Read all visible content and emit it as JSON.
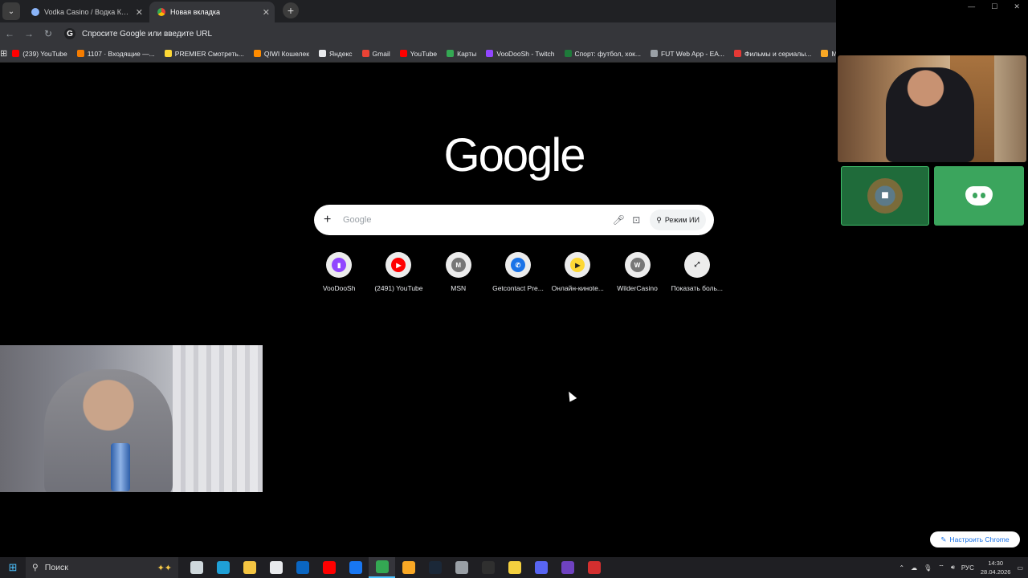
{
  "browser": {
    "tabs": [
      {
        "title": "Vodka Casino / Водка Казино -",
        "active": false
      },
      {
        "title": "Новая вкладка",
        "active": true
      }
    ],
    "omnibox_placeholder": "Спросите Google или введите URL",
    "bookmarks": [
      {
        "label": "(239) YouTube",
        "color": "#ff0000"
      },
      {
        "label": "1107 · Входящие —...",
        "color": "#f57c00"
      },
      {
        "label": "PREMIER Смотреть...",
        "color": "#fdd835"
      },
      {
        "label": "QIWI Кошелек",
        "color": "#ff8c00"
      },
      {
        "label": "Яндекс",
        "color": "#e8eaed"
      },
      {
        "label": "Gmail",
        "color": "#ea4335"
      },
      {
        "label": "YouTube",
        "color": "#ff0000"
      },
      {
        "label": "Карты",
        "color": "#34a853"
      },
      {
        "label": "VooDooSh - Twitch",
        "color": "#9146ff"
      },
      {
        "label": "Спорт: футбол, хок...",
        "color": "#1e7b3a"
      },
      {
        "label": "FUT Web App - EA...",
        "color": "#9aa0a6"
      },
      {
        "label": "Фильмы и сериалы...",
        "color": "#e53935"
      },
      {
        "label": "MyScore",
        "color": "#f9a825"
      }
    ]
  },
  "newtab": {
    "logo": "Google",
    "search_placeholder": "Google",
    "ai_mode_label": "Режим ИИ",
    "shortcuts": [
      {
        "label": "VooDooSh",
        "icon": "twitch-icon",
        "color": "#9146ff",
        "glyph": "▮"
      },
      {
        "label": "(2491) YouTube",
        "icon": "youtube-icon",
        "color": "#ff0000",
        "glyph": "▶"
      },
      {
        "label": "MSN",
        "icon": "letter-m-icon",
        "color": "#777777",
        "glyph": "M"
      },
      {
        "label": "Getcontact Pre...",
        "icon": "phone-icon",
        "color": "#1a73e8",
        "glyph": "✆"
      },
      {
        "label": "Онлайн-кинote...",
        "icon": "play-icon",
        "color": "#fdd835",
        "glyph": "▶"
      },
      {
        "label": "WilderCasino",
        "icon": "letter-w-icon",
        "color": "#777777",
        "glyph": "W"
      },
      {
        "label": "Показать боль...",
        "icon": "expand-icon",
        "color": "#ececec",
        "glyph": "⤢"
      }
    ],
    "customize_label": "Настроить Chrome"
  },
  "taskbar": {
    "search_label": "Поиск",
    "icons": [
      {
        "name": "task-view-icon",
        "color": "#cfd8dc"
      },
      {
        "name": "edge-icon",
        "color": "#1fa0d6"
      },
      {
        "name": "file-explorer-icon",
        "color": "#f4c542"
      },
      {
        "name": "store-icon",
        "color": "#e8eaed"
      },
      {
        "name": "outlook-icon",
        "color": "#0a66c2"
      },
      {
        "name": "youtube-app-icon",
        "color": "#ff0000"
      },
      {
        "name": "facebook-icon",
        "color": "#1877f2"
      },
      {
        "name": "chrome-icon",
        "color": "#34a853",
        "active": true
      },
      {
        "name": "app-icon",
        "color": "#f9a825"
      },
      {
        "name": "steam-icon",
        "color": "#1b2838"
      },
      {
        "name": "settings-icon",
        "color": "#9aa0a6"
      },
      {
        "name": "terminal-icon",
        "color": "#2f2f2f"
      },
      {
        "name": "app-yellow-icon",
        "color": "#f4d03f"
      },
      {
        "name": "discord-icon",
        "color": "#5865f2"
      },
      {
        "name": "obs-icon",
        "color": "#6f42c1"
      },
      {
        "name": "app-red-icon",
        "color": "#d32f2f"
      }
    ],
    "lang": "РУС",
    "time": "14:30",
    "date": "28.04.2026"
  }
}
